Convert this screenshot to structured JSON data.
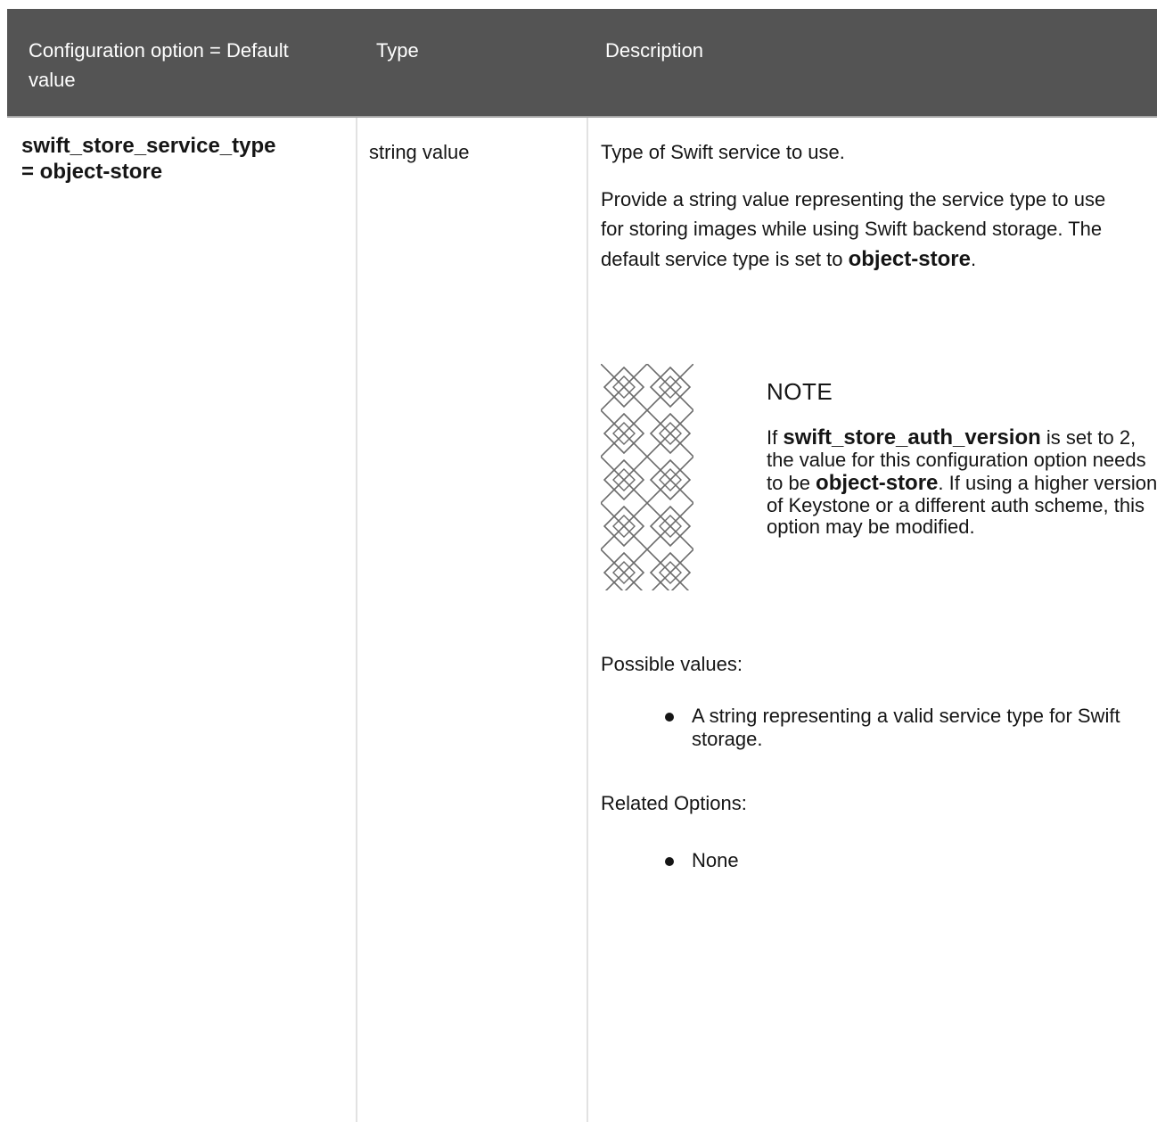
{
  "header": {
    "config_col": "Configuration option = Default value",
    "type_col": "Type",
    "desc_col": "Description"
  },
  "row": {
    "option_line1": "swift_store_service_type",
    "option_line2": "= object-store",
    "type": "string value",
    "desc_first": "Type of Swift service to use.",
    "desc_provide_text": "Provide a string value representing the service type to use for storing images while using Swift backend storage. The default service type is set to ",
    "desc_provide_code": "object-store",
    "desc_provide_end": ".",
    "note_icon": "note-pattern-icon",
    "note_title": "NOTE",
    "note_part1": "If ",
    "note_code1": "swift_store_auth_version",
    "note_part2": " is set to 2, the value for this configuration option needs to be ",
    "note_code2": "object-store",
    "note_part3": ". If using a higher version of Keystone or a different auth scheme, this option may be modified.",
    "possible_label": "Possible values:",
    "possible_item": "A string representing a valid service type for Swift storage.",
    "related_label": "Related Options:",
    "related_item": "None"
  },
  "colors": {
    "header_bg": "#545454",
    "header_text": "#ffffff",
    "divider": "#e2e2e2",
    "text": "#151515"
  }
}
